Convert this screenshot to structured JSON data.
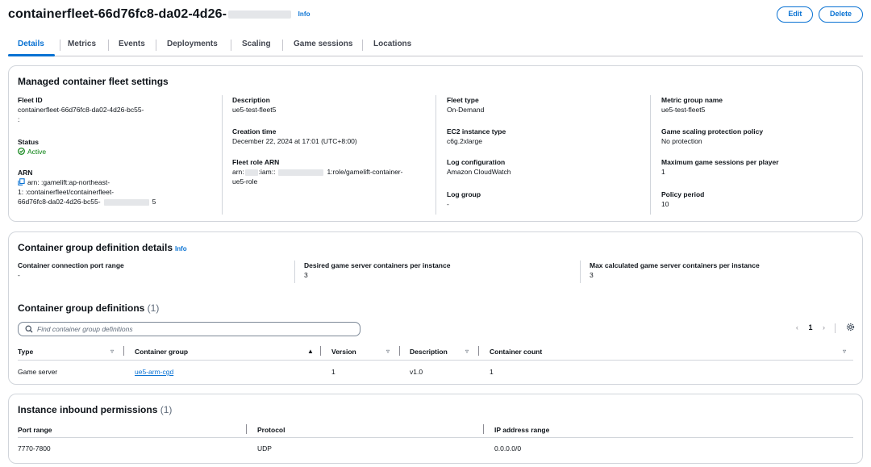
{
  "header": {
    "title_prefix": "containerfleet-66d76fc8-da02-4d26-",
    "title_tail": "●●●●●●",
    "info": "Info",
    "edit": "Edit",
    "delete": "Delete"
  },
  "tabs": [
    {
      "label": "Details"
    },
    {
      "label": "Metrics"
    },
    {
      "label": "Events"
    },
    {
      "label": "Deployments"
    },
    {
      "label": "Scaling"
    },
    {
      "label": "Game sessions"
    },
    {
      "label": "Locations"
    }
  ],
  "settings": {
    "title": "Managed container fleet settings",
    "fleet_id_label": "Fleet ID",
    "fleet_id_value": "containerfleet-66d76fc8-da02-4d26-bc55-",
    "fleet_id_value2": ":",
    "status_label": "Status",
    "status_value": "Active",
    "arn_label": "ARN",
    "arn_line1": "arn:        :gamelift:ap-northeast-",
    "arn_line2": "1:                :containerfleet/containerfleet-",
    "arn_line3": "66d76fc8-da02-4d26-bc55-",
    "arn_line3_tail": "5",
    "description_label": "Description",
    "description_value": "ue5-test-fleet5",
    "creation_label": "Creation time",
    "creation_value": "December 22, 2024 at 17:01 (UTC+8:00)",
    "role_label": "Fleet role ARN",
    "role_line1_a": "arn:",
    "role_line1_b": ":iam::",
    "role_line1_c": "1:role/gamelift-container-",
    "role_line2": "ue5-role",
    "fleet_type_label": "Fleet type",
    "fleet_type_value": "On-Demand",
    "ec2_label": "EC2 instance type",
    "ec2_value": "c6g.2xlarge",
    "log_config_label": "Log configuration",
    "log_config_value": "Amazon CloudWatch",
    "log_group_label": "Log group",
    "log_group_value": "-",
    "metric_group_label": "Metric group name",
    "metric_group_value": "ue5-test-fleet5",
    "scaling_policy_label": "Game scaling protection policy",
    "scaling_policy_value": "No protection",
    "max_sessions_label": "Maximum game sessions per player",
    "max_sessions_value": "1",
    "policy_period_label": "Policy period",
    "policy_period_value": "10"
  },
  "group_details": {
    "title": "Container group definition details",
    "info": "Info",
    "port_range_label": "Container connection port range",
    "port_range_value": "-",
    "desired_label": "Desired game server containers per instance",
    "desired_value": "3",
    "max_calc_label": "Max calculated game server containers per instance",
    "max_calc_value": "3",
    "defs_title": "Container group definitions",
    "defs_count": "(1)",
    "search_placeholder": "Find container group definitions",
    "page": "1",
    "columns": [
      "Type",
      "Container group",
      "Version",
      "Description",
      "Container count"
    ],
    "rows": [
      {
        "type": "Game server",
        "group": "ue5-arm-cgd",
        "version": "1",
        "description": "v1.0",
        "count": "1"
      }
    ]
  },
  "inbound": {
    "title": "Instance inbound permissions",
    "count": "(1)",
    "columns": [
      "Port range",
      "Protocol",
      "IP address range"
    ],
    "rows": [
      {
        "port": "7770-7800",
        "protocol": "UDP",
        "ip": "0.0.0.0/0"
      }
    ]
  },
  "colors": {
    "accent": "#0972d3",
    "success": "#037f0c",
    "border": "#d1d5db"
  }
}
